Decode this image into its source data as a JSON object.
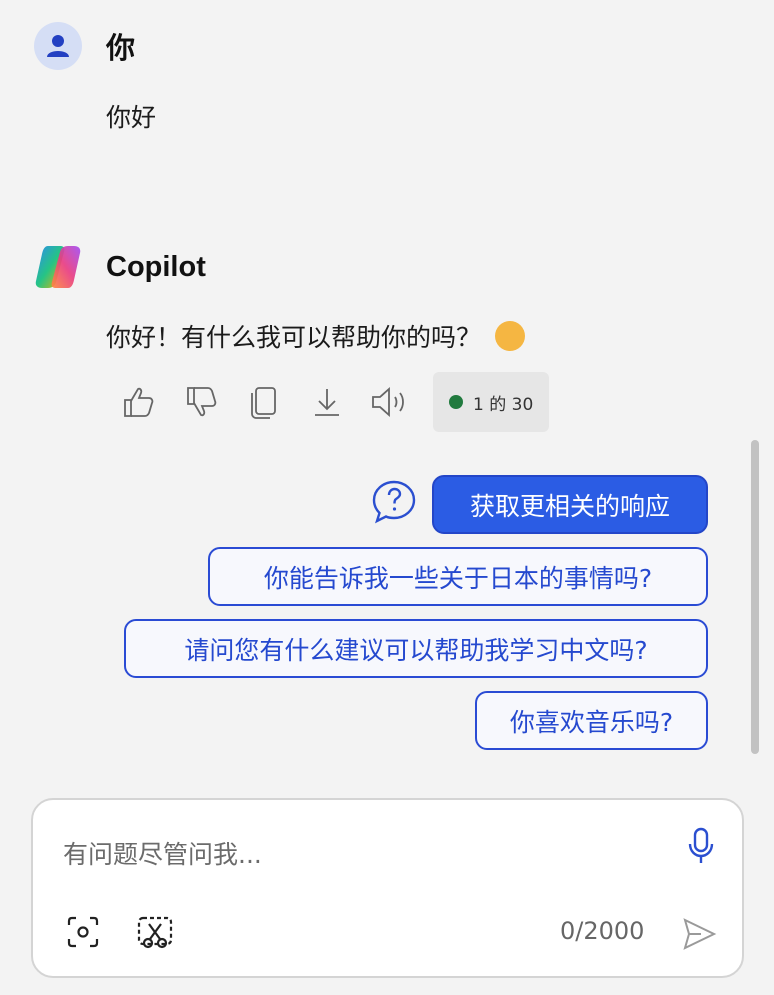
{
  "user_message": {
    "author": "你",
    "text": "你好"
  },
  "copilot_message": {
    "author": "Copilot",
    "text": "你好！有什么我可以帮助你的吗？",
    "emoji": "😊"
  },
  "actions": {
    "icons": [
      "thumbs-up-icon",
      "thumbs-down-icon",
      "copy-icon",
      "download-icon",
      "speaker-icon"
    ],
    "counter": "1 的 30",
    "counter_color": "#217a3e"
  },
  "suggestions": {
    "primary": "获取更相关的响应",
    "items": [
      "你能告诉我一些关于日本的事情吗?",
      "请问您有什么建议可以帮助我学习中文吗?",
      "你喜欢音乐吗?"
    ]
  },
  "composer": {
    "placeholder": "有问题尽管问我...",
    "char_count": "0/2000"
  },
  "colors": {
    "accent": "#2b5ce4",
    "chip_border": "#2a4bd4",
    "background": "#f3f3f3"
  }
}
